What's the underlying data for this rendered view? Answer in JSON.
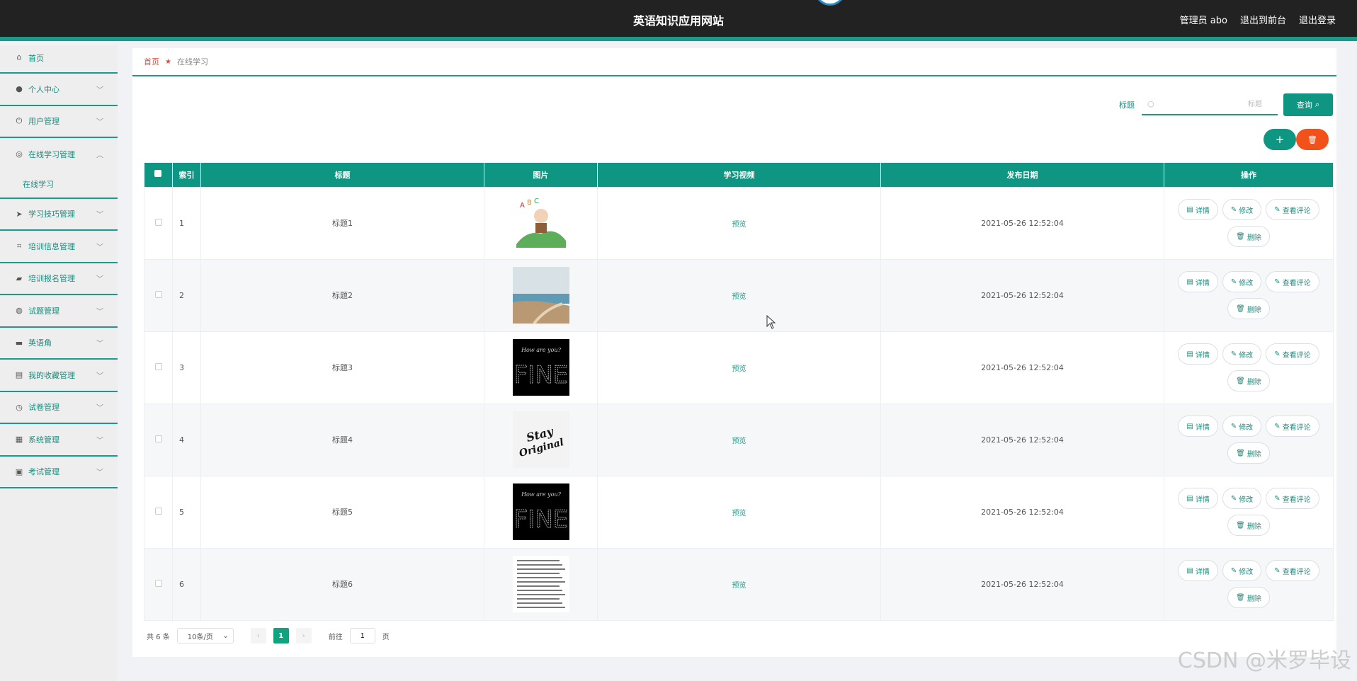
{
  "header": {
    "site_title": "英语知识应用网站",
    "user_label": "管理员 abo",
    "to_front": "退出到前台",
    "logout": "退出登录"
  },
  "sidebar": {
    "items": [
      {
        "label": "首页",
        "icon": "home-icon",
        "chevron": false
      },
      {
        "label": "个人中心",
        "icon": "user-icon",
        "chevron": true
      },
      {
        "label": "用户管理",
        "icon": "power-icon",
        "chevron": true
      },
      {
        "label": "在线学习管理",
        "icon": "compass-icon",
        "chevron": true,
        "expanded": true
      },
      {
        "label": "学习技巧管理",
        "icon": "send-icon",
        "chevron": true
      },
      {
        "label": "培训信息管理",
        "icon": "crop-icon",
        "chevron": true
      },
      {
        "label": "培训报名管理",
        "icon": "chat-icon",
        "chevron": true
      },
      {
        "label": "试题管理",
        "icon": "globe-icon",
        "chevron": true
      },
      {
        "label": "英语角",
        "icon": "briefcase-icon",
        "chevron": true
      },
      {
        "label": "我的收藏管理",
        "icon": "inbox-icon",
        "chevron": true
      },
      {
        "label": "试卷管理",
        "icon": "clock-icon",
        "chevron": true
      },
      {
        "label": "系统管理",
        "icon": "clipboard-icon",
        "chevron": true
      },
      {
        "label": "考试管理",
        "icon": "checklist-icon",
        "chevron": true
      }
    ],
    "submenu_label": "在线学习"
  },
  "breadcrumb": {
    "home": "首页",
    "current": "在线学习"
  },
  "search": {
    "label": "标题",
    "placeholder": "标题",
    "button": "查询"
  },
  "table": {
    "headers": [
      "索引",
      "标题",
      "图片",
      "学习视频",
      "发布日期",
      "操作"
    ],
    "preview_label": "预览",
    "ops": [
      "详情",
      "修改",
      "查看评论",
      "删除"
    ],
    "rows": [
      {
        "index": "1",
        "title": "标题1",
        "image": "abc-cartoon",
        "date": "2021-05-26 12:52:04"
      },
      {
        "index": "2",
        "title": "标题2",
        "image": "beach-path",
        "date": "2021-05-26 12:52:04"
      },
      {
        "index": "3",
        "title": "标题3",
        "image": "fine-black",
        "date": "2021-05-26 12:52:04"
      },
      {
        "index": "4",
        "title": "标题4",
        "image": "stay-original",
        "date": "2021-05-26 12:52:04"
      },
      {
        "index": "5",
        "title": "标题5",
        "image": "fine-black",
        "date": "2021-05-26 12:52:04"
      },
      {
        "index": "6",
        "title": "标题6",
        "image": "text-sheet",
        "date": "2021-05-26 12:52:04"
      }
    ]
  },
  "pager": {
    "total": "共 6 条",
    "size": "10条/页",
    "page": "1",
    "goto": "前往",
    "goto_value": "1",
    "page_suffix": "页"
  },
  "watermark": "CSDN @米罗毕设",
  "colors": {
    "accent": "#0f9683",
    "danger": "#f3511a",
    "header_bg": "#222222"
  }
}
